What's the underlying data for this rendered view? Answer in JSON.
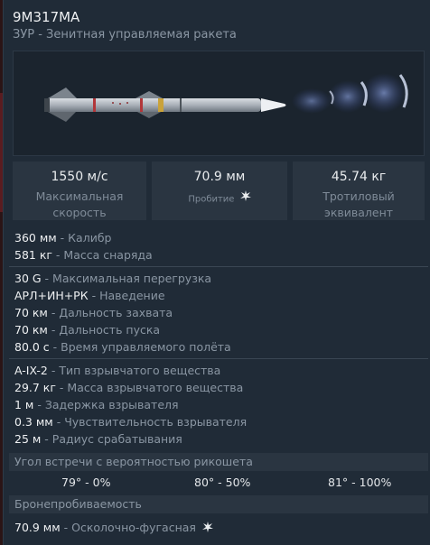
{
  "header": {
    "title": "9М317МА",
    "subtitle": "ЗУР - Зенитная управляемая ракета"
  },
  "stats": [
    {
      "value": "1550 м/с",
      "label_line1": "Максимальная",
      "label_line2": "скорость"
    },
    {
      "value": "70.9 мм",
      "label": "Пробитие"
    },
    {
      "value": "45.74 кг",
      "label_line1": "Тротиловый",
      "label_line2": "эквивалент"
    }
  ],
  "group1": [
    {
      "value": "360 мм",
      "desc": "Калибр"
    },
    {
      "value": "581 кг",
      "desc": "Масса снаряда"
    }
  ],
  "group2": [
    {
      "value": "30 G",
      "desc": "Максимальная перегрузка"
    },
    {
      "value": "АРЛ+ИН+РК",
      "desc": "Наведение"
    },
    {
      "value": "70 км",
      "desc": "Дальность захвата"
    },
    {
      "value": "70 км",
      "desc": "Дальность пуска"
    },
    {
      "value": "80.0 с",
      "desc": "Время управляемого полёта"
    }
  ],
  "group3": [
    {
      "value": "A-IX-2",
      "desc": "Тип взрывчатого вещества"
    },
    {
      "value": "29.7 кг",
      "desc": "Масса взрывчатого вещества"
    },
    {
      "value": "1 м",
      "desc": "Задержка взрывателя"
    },
    {
      "value": "0.3 мм",
      "desc": "Чувствительность взрывателя"
    },
    {
      "value": "25 м",
      "desc": "Радиус срабатывания"
    }
  ],
  "ricochet": {
    "title": "Угол встречи с вероятностью рикошета",
    "values": [
      "79° - 0%",
      "80° - 50%",
      "81° - 100%"
    ]
  },
  "armor": {
    "title": "Бронепробиваемость",
    "value": "70.9 мм",
    "desc": "Осколочно-фугасная"
  },
  "icons": {
    "penetration": "he-burst-icon"
  },
  "colors": {
    "background": "#202b37",
    "panel": "#2a3541",
    "text": "#eef0f2",
    "muted": "#8a96a3"
  }
}
